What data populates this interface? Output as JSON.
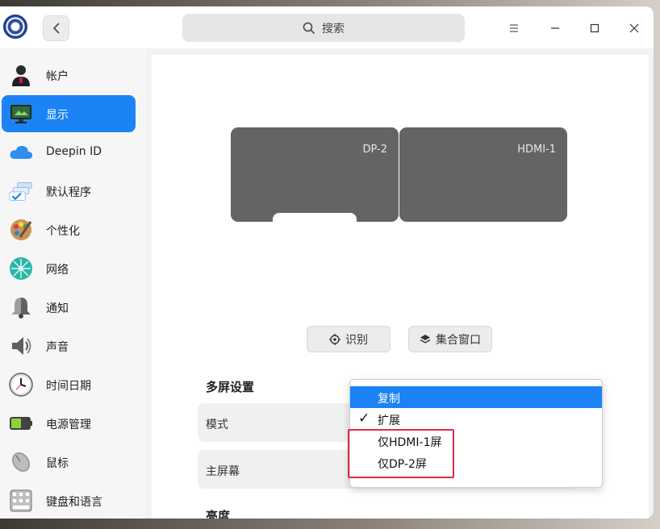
{
  "search": {
    "label": "搜索"
  },
  "sidebar": {
    "items": [
      {
        "label": "帐户",
        "icon": "user-icon"
      },
      {
        "label": "显示",
        "icon": "monitor-icon",
        "active": true
      },
      {
        "label": "Deepin ID",
        "icon": "cloud-icon"
      },
      {
        "label": "默认程序",
        "icon": "default-apps-icon"
      },
      {
        "label": "个性化",
        "icon": "palette-icon"
      },
      {
        "label": "网络",
        "icon": "network-icon"
      },
      {
        "label": "通知",
        "icon": "bell-icon"
      },
      {
        "label": "声音",
        "icon": "speaker-icon"
      },
      {
        "label": "时间日期",
        "icon": "clock-icon"
      },
      {
        "label": "电源管理",
        "icon": "battery-icon"
      },
      {
        "label": "鼠标",
        "icon": "mouse-icon"
      },
      {
        "label": "键盘和语言",
        "icon": "keyboard-icon"
      }
    ]
  },
  "display": {
    "monitors": [
      {
        "label": "DP-2",
        "primary": true
      },
      {
        "label": "HDMI-1",
        "primary": false
      }
    ],
    "identify_label": "识别",
    "gather_windows_label": "集合窗口",
    "multi_screen_title": "多屏设置",
    "mode_label": "模式",
    "primary_screen_label": "主屏幕",
    "brightness_title": "亮度"
  },
  "dropdown": {
    "options": [
      {
        "label": "复制",
        "highlighted": true,
        "checked": false
      },
      {
        "label": "扩展",
        "highlighted": false,
        "checked": true
      },
      {
        "label": "仅HDMI-1屏",
        "highlighted": false,
        "checked": false
      },
      {
        "label": "仅DP-2屏",
        "highlighted": false,
        "checked": false
      }
    ]
  },
  "colors": {
    "accent": "#1c83f5",
    "monitor": "#646464",
    "annotation": "#e0284d"
  }
}
